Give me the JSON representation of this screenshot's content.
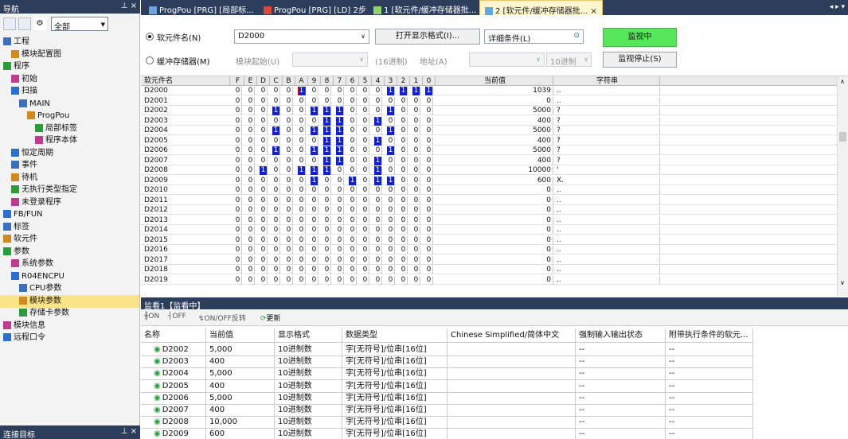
{
  "nav": {
    "title": "导航",
    "filter": "全部",
    "footer": "连接目标",
    "items": [
      {
        "label": "工程",
        "indent": 0
      },
      {
        "label": "模块配置图",
        "indent": 1
      },
      {
        "label": "程序",
        "indent": 0
      },
      {
        "label": "初始",
        "indent": 1
      },
      {
        "label": "扫描",
        "indent": 1
      },
      {
        "label": "MAIN",
        "indent": 2
      },
      {
        "label": "ProgPou",
        "indent": 3
      },
      {
        "label": "局部标签",
        "indent": 4
      },
      {
        "label": "程序本体",
        "indent": 4
      },
      {
        "label": "恒定周期",
        "indent": 1
      },
      {
        "label": "事件",
        "indent": 1
      },
      {
        "label": "待机",
        "indent": 1
      },
      {
        "label": "无执行类型指定",
        "indent": 1
      },
      {
        "label": "未登录程序",
        "indent": 1
      },
      {
        "label": "FB/FUN",
        "indent": 0
      },
      {
        "label": "标签",
        "indent": 0
      },
      {
        "label": "软元件",
        "indent": 0
      },
      {
        "label": "参数",
        "indent": 0
      },
      {
        "label": "系统参数",
        "indent": 1
      },
      {
        "label": "R04ENCPU",
        "indent": 1
      },
      {
        "label": "CPU参数",
        "indent": 2
      },
      {
        "label": "模块参数",
        "indent": 2
      },
      {
        "label": "存储卡参数",
        "indent": 2
      },
      {
        "label": "模块信息",
        "indent": 0
      },
      {
        "label": "远程口令",
        "indent": 0
      }
    ]
  },
  "tabs": [
    {
      "label": "ProgPou [PRG] [局部标..."
    },
    {
      "label": "ProgPou [PRG] [LD] 2步"
    },
    {
      "label": "1 [软元件/缓冲存储器批..."
    },
    {
      "label": "2 [软元件/缓冲存储器批... ×"
    }
  ],
  "control": {
    "device_radio": "软元件名(N)",
    "device_value": "D2000",
    "open_format": "打开显示格式(I)...",
    "detail": "详细条件(L)",
    "monitoring": "监视中",
    "buffer_radio": "缓冲存储器(M)",
    "module_start": "模块起始(U)",
    "base_hex": "(16进制)",
    "address": "地址(A)",
    "base_dec": "10进制",
    "stop_monitor": "监视停止(S)"
  },
  "grid": {
    "col_device": "软元件名",
    "bit_headers": [
      "F",
      "E",
      "D",
      "C",
      "B",
      "A",
      "9",
      "8",
      "7",
      "6",
      "5",
      "4",
      "3",
      "2",
      "1",
      "0"
    ],
    "col_value": "当前值",
    "col_string": "字符串",
    "rows": [
      {
        "device": "D2000",
        "bits": "0000010000001111",
        "value": "1039",
        "str": ".."
      },
      {
        "device": "D2001",
        "bits": "0000000000000000",
        "value": "0",
        "str": ".."
      },
      {
        "device": "D2002",
        "bits": "0001001110001000",
        "value": "5000",
        "str": "?"
      },
      {
        "device": "D2003",
        "bits": "0000000110010000",
        "value": "400",
        "str": "?"
      },
      {
        "device": "D2004",
        "bits": "0001001110001000",
        "value": "5000",
        "str": "?"
      },
      {
        "device": "D2005",
        "bits": "0000000110010000",
        "value": "400",
        "str": "?"
      },
      {
        "device": "D2006",
        "bits": "0001001110001000",
        "value": "5000",
        "str": "?"
      },
      {
        "device": "D2007",
        "bits": "0000000110010000",
        "value": "400",
        "str": "?"
      },
      {
        "device": "D2008",
        "bits": "0010011100010000",
        "value": "10000",
        "str": "'"
      },
      {
        "device": "D2009",
        "bits": "0000001001011000",
        "value": "600",
        "str": "X."
      },
      {
        "device": "D2010",
        "bits": "0000000000000000",
        "value": "0",
        "str": ".."
      },
      {
        "device": "D2011",
        "bits": "0000000000000000",
        "value": "0",
        "str": ".."
      },
      {
        "device": "D2012",
        "bits": "0000000000000000",
        "value": "0",
        "str": ".."
      },
      {
        "device": "D2013",
        "bits": "0000000000000000",
        "value": "0",
        "str": ".."
      },
      {
        "device": "D2014",
        "bits": "0000000000000000",
        "value": "0",
        "str": ".."
      },
      {
        "device": "D2015",
        "bits": "0000000000000000",
        "value": "0",
        "str": ".."
      },
      {
        "device": "D2016",
        "bits": "0000000000000000",
        "value": "0",
        "str": ".."
      },
      {
        "device": "D2017",
        "bits": "0000000000000000",
        "value": "0",
        "str": ".."
      },
      {
        "device": "D2018",
        "bits": "0000000000000000",
        "value": "0",
        "str": ".."
      },
      {
        "device": "D2019",
        "bits": "0000000000000000",
        "value": "0",
        "str": ".."
      }
    ]
  },
  "watch": {
    "title": "监看1【监看中】",
    "tool_on": "ON",
    "tool_off": "OFF",
    "tool_toggle": "ON/OFF反转",
    "tool_update": "更新",
    "headers": [
      "名称",
      "当前值",
      "显示格式",
      "数据类型",
      "Chinese Simplified/简体中文",
      "强制输入输出状态",
      "附带执行条件的软元..."
    ],
    "rows": [
      {
        "name": "D2002",
        "value": "5,000",
        "format": "10进制数",
        "type": "字[无符号]/位串[16位]",
        "comment": "",
        "force": "--",
        "cond": "--"
      },
      {
        "name": "D2003",
        "value": "400",
        "format": "10进制数",
        "type": "字[无符号]/位串[16位]",
        "comment": "",
        "force": "--",
        "cond": "--"
      },
      {
        "name": "D2004",
        "value": "5,000",
        "format": "10进制数",
        "type": "字[无符号]/位串[16位]",
        "comment": "",
        "force": "--",
        "cond": "--"
      },
      {
        "name": "D2005",
        "value": "400",
        "format": "10进制数",
        "type": "字[无符号]/位串[16位]",
        "comment": "",
        "force": "--",
        "cond": "--"
      },
      {
        "name": "D2006",
        "value": "5,000",
        "format": "10进制数",
        "type": "字[无符号]/位串[16位]",
        "comment": "",
        "force": "--",
        "cond": "--"
      },
      {
        "name": "D2007",
        "value": "400",
        "format": "10进制数",
        "type": "字[无符号]/位串[16位]",
        "comment": "",
        "force": "--",
        "cond": "--"
      },
      {
        "name": "D2008",
        "value": "10,000",
        "format": "10进制数",
        "type": "字[无符号]/位串[16位]",
        "comment": "",
        "force": "--",
        "cond": "--"
      },
      {
        "name": "D2009",
        "value": "600",
        "format": "10进制数",
        "type": "字[无符号]/位串[16位]",
        "comment": "",
        "force": "--",
        "cond": "--"
      }
    ]
  },
  "colors": {
    "titlebar": "#2c3e5c",
    "bit_on": "#1120d8",
    "monitor_button": "#55e85a",
    "selected_nav": "#fbe38a"
  }
}
